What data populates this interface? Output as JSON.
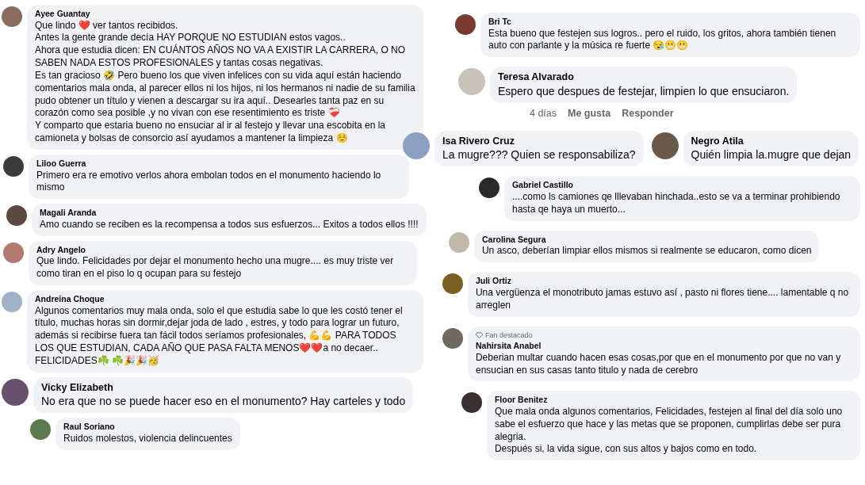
{
  "left_column": [
    {
      "kind": "comment",
      "name": "Ayee Guantay",
      "text": "Que lindo ❤️ ver tantos recibidos.\nAntes la gente grande decía HAY PORQUE NO ESTUDIAN estos vagos..\nAhora que estudia dicen: EN CUÁNTOS AÑOS NO VA A EXISTIR LA CARRERA, O NO SABEN NADA ESTOS PROFESIONALES y tantas cosas negativas.\nEs tan gracioso 🤣 Pero bueno los que viven infelices con su vida aquí están haciendo comentarios mala onda, al parecer ellos ni los hijos, ni los hermanos ni nadie de su familia pudo obtener un título y vienen a descargar su ira aquí.. Desearles tanta paz en su corazón como sea posible ,y no vivan con ese resentimiento es triste ❤️‍🩹\nY comparto que estaria bueno no ensuciar al ir al festejo y llevar una escobita en la camioneta y bolsas de consorcio así ayudamos a mantener la limpieza ☺️"
    },
    {
      "kind": "comment",
      "name": "Liloo Guerra",
      "text": "Primero era re emotivo verlos ahora embolan todos en el monumento haciendo lo mismo"
    },
    {
      "kind": "comment",
      "name": "Magali Aranda",
      "text": "Amo cuando se reciben es la recompensa a todos sus esfuerzos... Exitos a todos ellos !!!!"
    },
    {
      "kind": "comment",
      "name": "Adry Angelo",
      "text": "Que lindo. Felicidades por dejar el monumento hecho una mugre.... es muy triste ver como tiran en el piso lo q ocupan para su festejo"
    },
    {
      "kind": "comment",
      "name": "Andreina Choque",
      "text": "Algunos comentarios muy mala onda, solo el que estudia sabe lo que les costó tener el título, muchas horas sin dormir,dejar joda de lado , estres, y todo para lograr un futuro, además si recibirse fuera tan fácil todos seríamos profesionales, 💪💪 PARA TODOS LOS QUE ESTUDIAN, CADA AÑO QUE PASA FALTA MENOS❤️❤️a no decaer.. FELICIDADES☘️ ☘️🎉🎉🥳"
    },
    {
      "kind": "comment",
      "name": "Vicky Elizabeth",
      "text": "No era que no se puede hacer eso en el monumento? Hay carteles y todo"
    },
    {
      "kind": "comment",
      "name": "Raul Soriano",
      "text": "Ruidos molestos, violencia delincuentes"
    }
  ],
  "right_column": [
    {
      "kind": "comment",
      "name": "Bri Tc",
      "text": "Esta bueno que festejen sus logros.. pero el ruido, los gritos, ahora también tienen auto con parlante y la música re fuerte 😪😬😬"
    },
    {
      "kind": "comment",
      "name": "Teresa Alvarado",
      "text": "Espero que despues de festejar, limpien lo que ensuciaron.",
      "actions": [
        "4 días",
        "Me gusta",
        "Responder"
      ]
    },
    {
      "kind": "pair",
      "items": [
        {
          "name": "Isa Rivero Cruz",
          "text": "La mugre??? Quien se responsabiliza?"
        },
        {
          "name": "Negro Atila",
          "text": "Quién limpia la.mugre que dejan"
        }
      ]
    },
    {
      "kind": "comment",
      "name": "Gabriel Castillo",
      "text": "....como ls camiones qe lllevaban hinchada..esto se va a terminar prohibiendo hasta qe haya un muerto..."
    },
    {
      "kind": "comment",
      "name": "Carolina Segura",
      "text": "Un asco, deberían limpiar ellos mismos si realmente se educaron, como dicen"
    },
    {
      "kind": "comment",
      "name": "Juli Ortiz",
      "text": "Una vergüenza el monotributo jamas estuvo así , pasto ni flores tiene.... lamentable q no arreglen"
    },
    {
      "kind": "comment",
      "name": "Nahirsita Anabel",
      "badge": "Fan destacado",
      "text": "Deberian multar cuando hacen esas cosas,por que en el monumento por que no van y ensucian en sus casas tanto titulo y nada de cerebro"
    },
    {
      "kind": "comment",
      "name": "Floor Benitez",
      "text": "Que mala onda algunos comentarios, Felicidades, festejen al final del día solo uno sabe el esfuerzo que hace y las metas que se proponen, cumplirlas debe ser pura alegria.\nDespués si, la vida sigue, con sus altos y bajos como en todo."
    }
  ]
}
